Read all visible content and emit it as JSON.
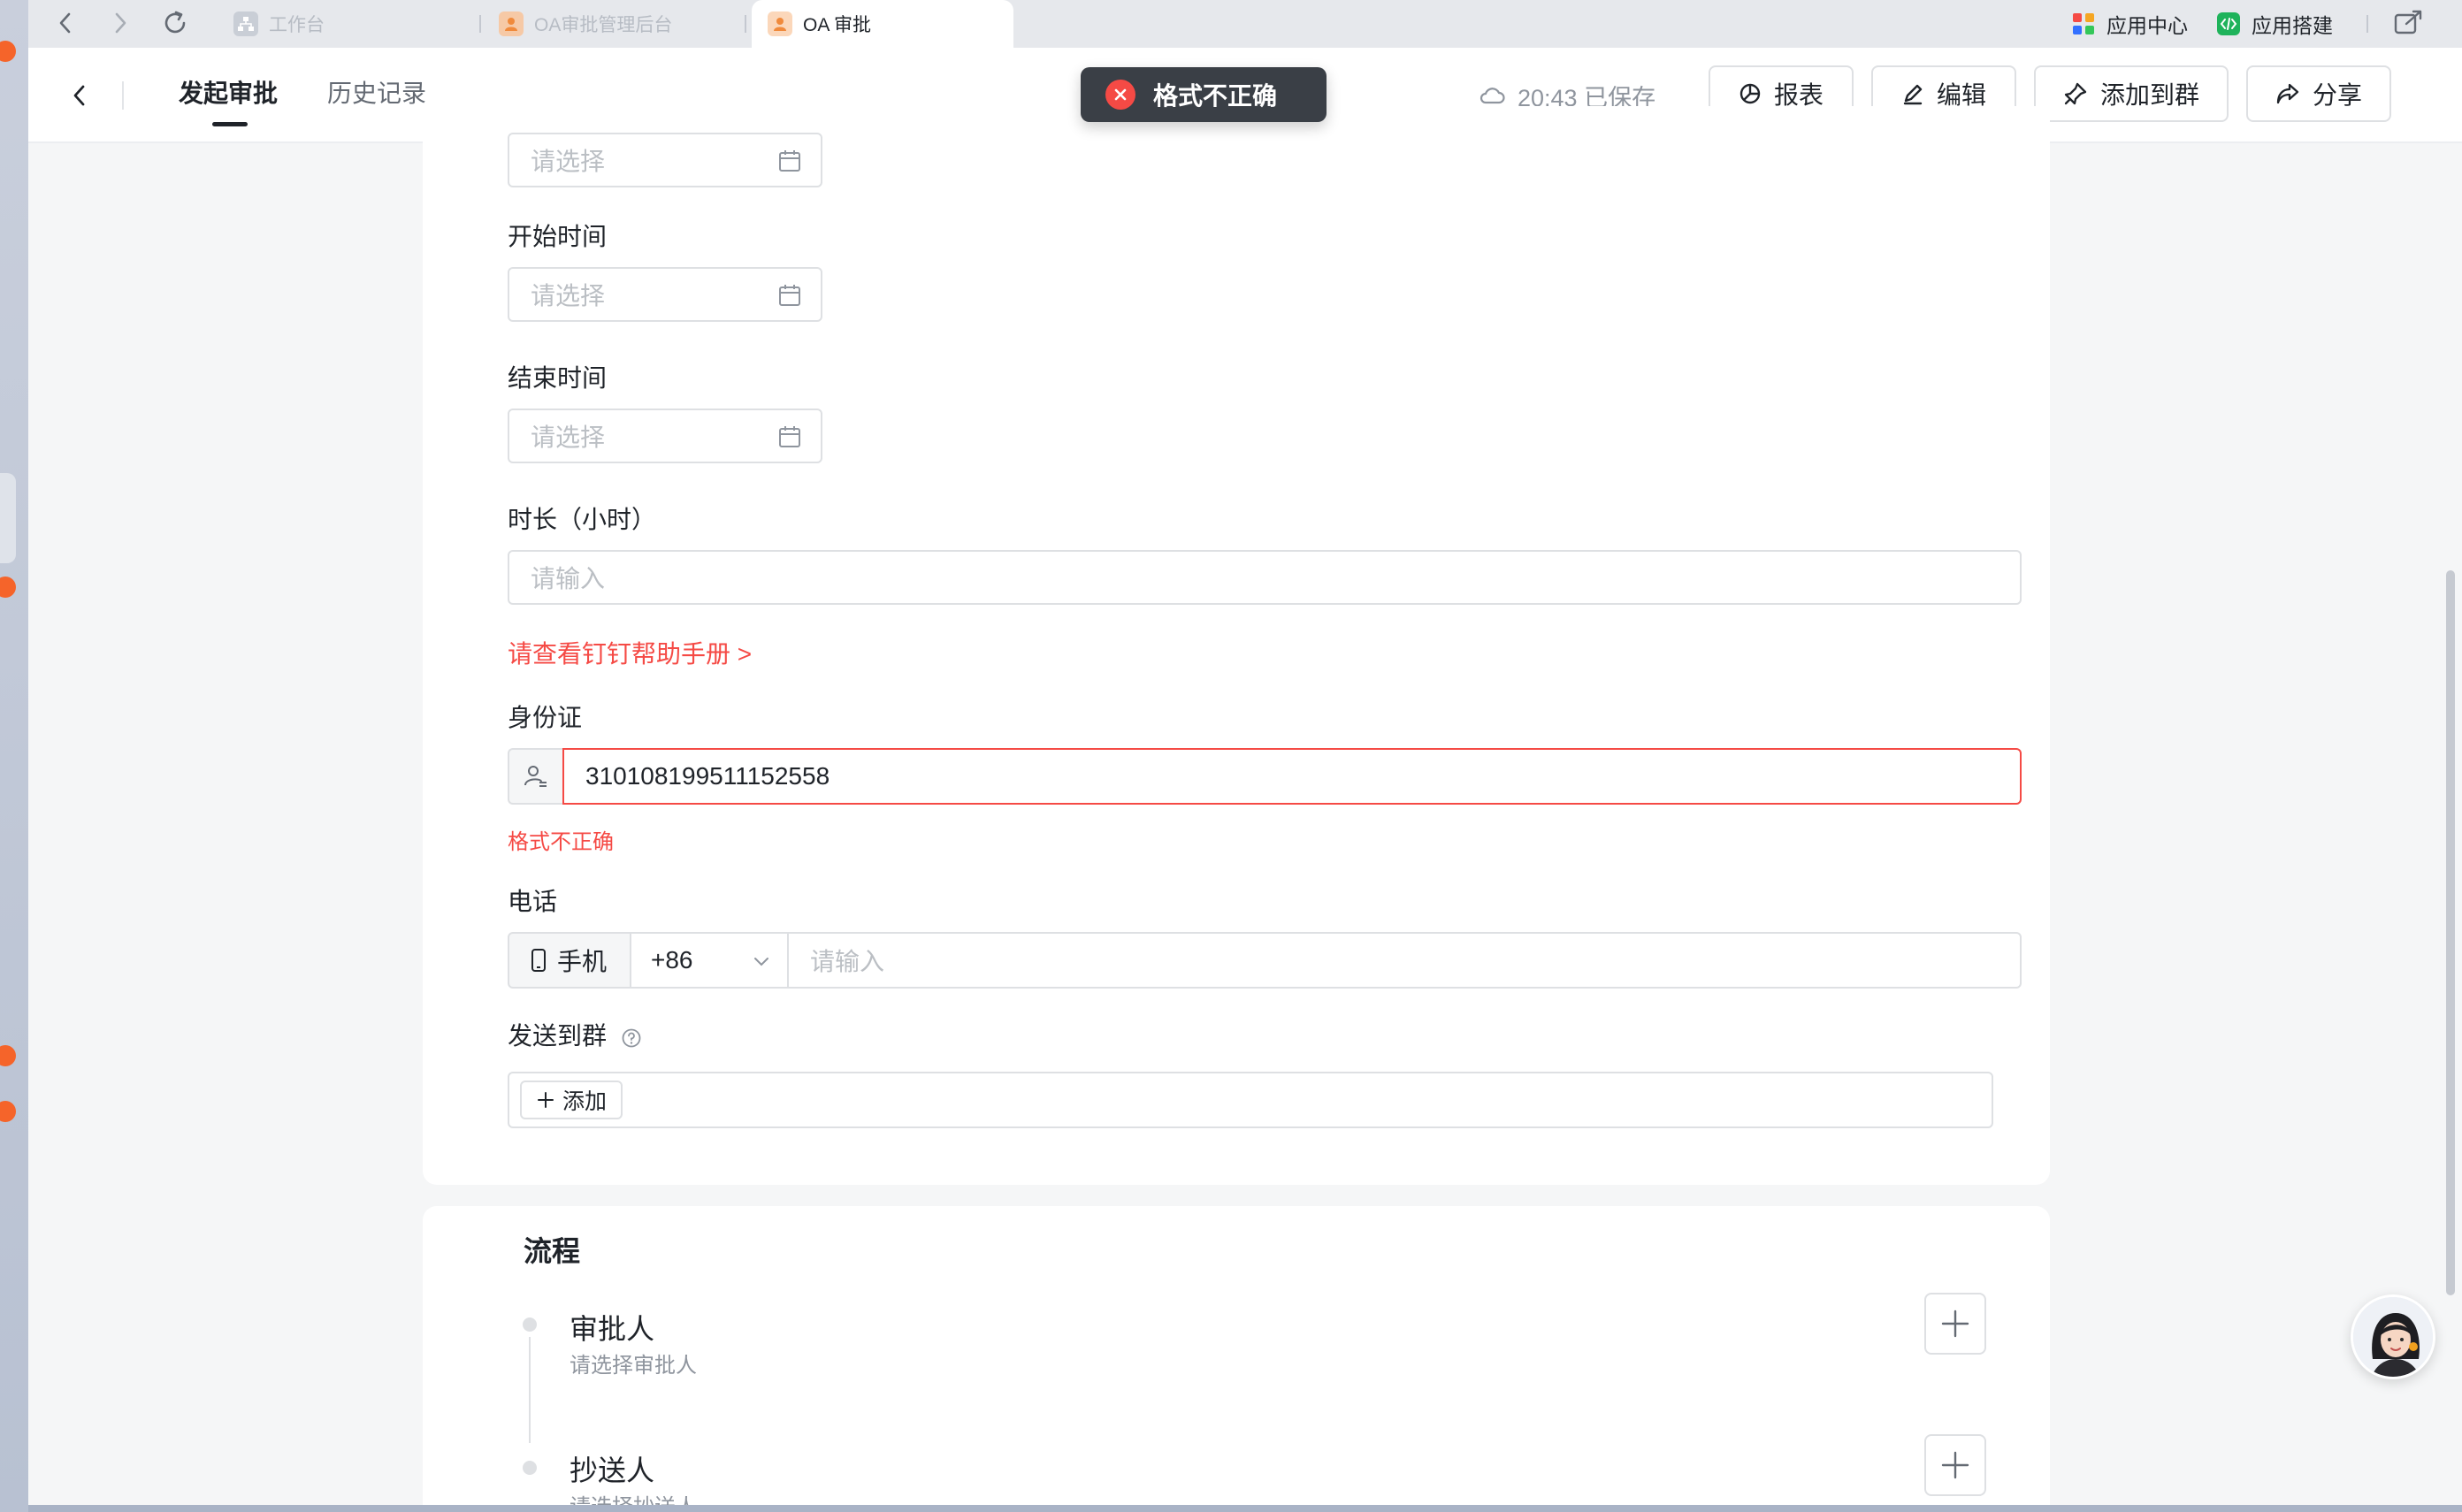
{
  "browser": {
    "tabs": [
      {
        "label": "工作台",
        "icon": "org-chart-icon"
      },
      {
        "label": "OA审批管理后台",
        "icon": "user-approval-icon"
      },
      {
        "label": "OA 审批",
        "icon": "user-approval-icon",
        "active": true
      }
    ],
    "app_center": "应用中心",
    "app_builder": "应用搭建"
  },
  "header": {
    "tab_start": "发起审批",
    "tab_history": "历史记录",
    "save_status": "20:43 已保存",
    "buttons": {
      "report": "报表",
      "edit": "编辑",
      "add_to_group": "添加到群",
      "share": "分享"
    }
  },
  "toast": {
    "message": "格式不正确"
  },
  "form": {
    "first_date_placeholder": "请选择",
    "start_time": {
      "label": "开始时间",
      "placeholder": "请选择"
    },
    "end_time": {
      "label": "结束时间",
      "placeholder": "请选择"
    },
    "duration": {
      "label": "时长（小时）",
      "placeholder": "请输入"
    },
    "help_link": "请查看钉钉帮助手册 >",
    "id_card": {
      "label": "身份证",
      "value": "310108199511152558",
      "error": "格式不正确"
    },
    "phone": {
      "label": "电话",
      "type": "手机",
      "code": "+86",
      "placeholder": "请输入"
    },
    "send_to_group": {
      "label": "发送到群",
      "add": "添加"
    }
  },
  "flow": {
    "title": "流程",
    "steps": [
      {
        "title": "审批人",
        "subtitle": "请选择审批人"
      },
      {
        "title": "抄送人",
        "subtitle": "请选择抄送人"
      }
    ]
  },
  "colors": {
    "error": "#f54a45",
    "toast_bg": "#3a3f46",
    "border": "#dee0e3",
    "page_bg": "#f5f6f7"
  }
}
